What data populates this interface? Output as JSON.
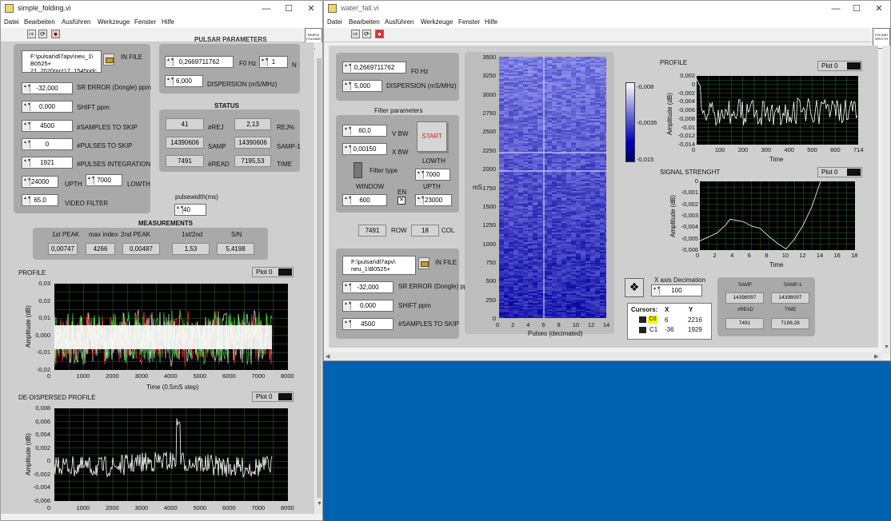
{
  "left_window": {
    "title": "simple_folding.vi",
    "menu": [
      "Datei",
      "Bearbeiten",
      "Ausführen",
      "Werkzeuge",
      "Fenster",
      "Hilfe"
    ],
    "logo_text": "SIMPLE FOLDING",
    "input_file": {
      "path": "F:\\pulsar\\dl7apv\\neu_1\\ B0525+ 21_2020mrz17_1545pdc",
      "label": "IN FILE"
    },
    "controls": [
      {
        "value": "-32,000",
        "label": "SR ERROR (Dongle) ppm"
      },
      {
        "value": "0,000",
        "label": "SHIFT ppm"
      },
      {
        "value": "4500",
        "label": "#SAMPLES TO SKIP"
      },
      {
        "value": "0",
        "label": "#PULSES TO SKIP"
      },
      {
        "value": "1921",
        "label": "#PULSES INTEGRATION"
      }
    ],
    "upth": {
      "value": "24000",
      "label": "UPTH"
    },
    "lowth": {
      "value": "7000",
      "label": "LOWTH"
    },
    "video_filter": {
      "value": "65,0",
      "label": "VIDEO FILTER"
    },
    "pulsar_header": "PULSAR PARAMETERS",
    "f0": {
      "value": "0,2669711762",
      "label": "F0 Hz"
    },
    "n": {
      "value": "1",
      "label": "N"
    },
    "dispersion": {
      "value": "6,000",
      "label": "DISPERSION (mS/MHz)"
    },
    "status": {
      "title": "STATUS",
      "rej": {
        "value": "41",
        "label": "#REJ"
      },
      "rej_pct": {
        "value": "2,13",
        "label": "REJ%"
      },
      "samp": {
        "value": "14390606",
        "label": "SAMP"
      },
      "samp1": {
        "value": "14390606",
        "label": "SAMP-1"
      },
      "read": {
        "value": "7491",
        "label": "#READ"
      },
      "time": {
        "value": "7195,53",
        "label": "TIME"
      }
    },
    "pulsewidth": {
      "label": "pulsewidth(ms)",
      "value": "40"
    },
    "measurements": {
      "title": "MEASUREMENTS",
      "headers": [
        "1st PEAK",
        "max index",
        "2nd PEAK",
        "1st/2nd",
        "S/N"
      ],
      "values": [
        "0,00747",
        "4266",
        "0,00487",
        "1,53",
        "5,4198"
      ]
    },
    "profile_chart": {
      "title": "PROFILE",
      "legend": "Plot 0",
      "ylabel": "Amplitude (dB)",
      "xlabel": "Time (0.5mS step)",
      "xticks": [
        "0",
        "1000",
        "2000",
        "3000",
        "4000",
        "5000",
        "6000",
        "7000",
        "8000"
      ],
      "yticks": [
        "0,03",
        "0,02",
        "0,01",
        "0,000",
        "-0,01",
        "-0,02"
      ]
    },
    "dedispersed_chart": {
      "title": "DE-DISPERSED PROFILE",
      "legend": "Plot 0",
      "ylabel": "Amplitude (dB)",
      "xticks": [
        "0",
        "1000",
        "2000",
        "3000",
        "4000",
        "5000",
        "6000",
        "7000",
        "8000"
      ],
      "yticks": [
        "0,008",
        "0,006",
        "0,004",
        "0,002",
        "0",
        "-0,002",
        "-0,004",
        "-0,006"
      ]
    }
  },
  "right_window": {
    "title": "water_fall.vi",
    "menu": [
      "Datei",
      "Bearbeiten",
      "Ausführen",
      "Werkzeuge",
      "Fenster",
      "Hilfe"
    ],
    "logo_text": "PULSAR SPECTR",
    "f0": {
      "value": "0,2669711762",
      "label": "F0 Hz"
    },
    "dispersion": {
      "value": "5,000",
      "label": "DISPERSION (mS/MHz)"
    },
    "filter": {
      "title": "Filter parameters",
      "vbw": {
        "value": "60,0",
        "label": "V BW"
      },
      "xbw": {
        "value": "0,00150",
        "label": "X BW"
      },
      "filter_type_label": "Filter type",
      "start_label": "START",
      "lowth": {
        "value": "7000",
        "label": "LOWTH"
      },
      "window": {
        "value": "600",
        "label": "WINDOW"
      },
      "en_label": "EN",
      "upth": {
        "value": "23000",
        "label": "UPTH"
      }
    },
    "row": {
      "value": "7491",
      "label": "ROW"
    },
    "col": {
      "value": "18",
      "label": "COL"
    },
    "input_file": {
      "path": "F:\\pulsar\\dl7apv\\ neu_1\\B0525+",
      "label": "IN FILE"
    },
    "sr_error": {
      "value": "-32,000",
      "label": "SR ERROR (Dongle) ppm"
    },
    "shift": {
      "value": "0,000",
      "label": "SHIFT ppm"
    },
    "samples_skip": {
      "value": "4500",
      "label": "#SAMPLES TO SKIP"
    },
    "waterfall": {
      "ylabel": "mS",
      "xlabel": "Pulses (decimated)",
      "yticks": [
        "3500",
        "3250",
        "3000",
        "2750",
        "2500",
        "2250",
        "2000",
        "1750",
        "1500",
        "1250",
        "1000",
        "750",
        "500",
        "250",
        "0"
      ],
      "xticks": [
        "0",
        "2",
        "4",
        "6",
        "8",
        "10",
        "12",
        "14"
      ]
    },
    "colorscale": {
      "labels": [
        "-0,008",
        "-0,0035",
        "-0,015"
      ]
    },
    "profile_chart": {
      "title": "PROFILE",
      "legend": "Plot 0",
      "ylabel": "Amplitude (dB)",
      "xlabel": "Time",
      "yticks": [
        "0,002",
        "0",
        "-0,002",
        "-0,004",
        "-0,006",
        "-0,008",
        "-0,01",
        "-0,012",
        "-0,014"
      ],
      "xticks": [
        "0",
        "100",
        "200",
        "300",
        "400",
        "500",
        "600",
        "714"
      ]
    },
    "signal_chart": {
      "title": "SIGNAL STRENGHT",
      "legend": "Plot 0",
      "ylabel": "Amplitude (dB)",
      "xlabel": "Time",
      "yticks": [
        "0",
        "-0,001",
        "-0,002",
        "-0,003",
        "-0,004",
        "-0,005",
        "-0,006"
      ],
      "xticks": [
        "0",
        "2",
        "4",
        "6",
        "8",
        "10",
        "12",
        "14",
        "16",
        "18"
      ]
    },
    "x_decimation": {
      "label": "X axis Decimation",
      "value": "100"
    },
    "cursors": {
      "headers": [
        "Cursors:",
        "X",
        "Y"
      ],
      "rows": [
        [
          "C0",
          "6",
          "2216"
        ],
        [
          "C1",
          "-36",
          "1929"
        ]
      ]
    },
    "status_mini": {
      "samp_label": "SAMP",
      "samp1_label": "SAMP-1",
      "samp": "14398097",
      "samp1": "14398097",
      "read_label": "#READ",
      "time_label": "TIME",
      "read": "7491",
      "time": "7199,28"
    }
  }
}
